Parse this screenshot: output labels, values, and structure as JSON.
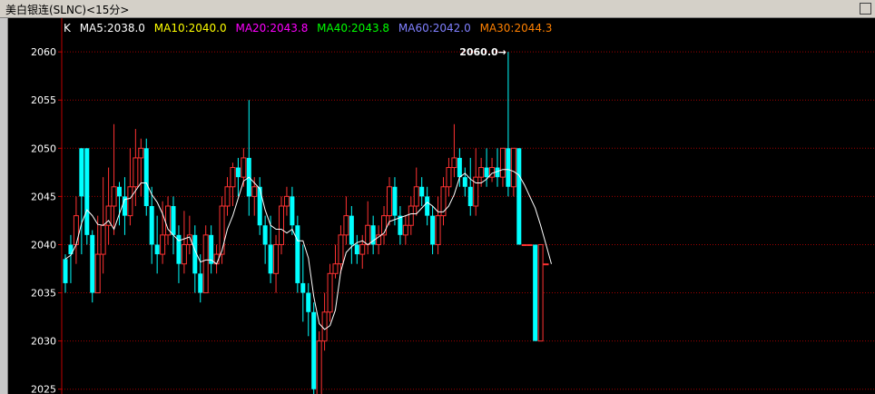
{
  "window": {
    "title": "美白银连(SLNC)<15分>"
  },
  "legend": {
    "type_label": "K",
    "items": [
      {
        "label": "MA5:2038.0",
        "color": "#ffffff"
      },
      {
        "label": "MA10:2040.0",
        "color": "#ffff00"
      },
      {
        "label": "MA20:2043.8",
        "color": "#ff00ff"
      },
      {
        "label": "MA40:2043.8",
        "color": "#00ff00"
      },
      {
        "label": "MA60:2042.0",
        "color": "#8080ff"
      },
      {
        "label": "MA30:2044.3",
        "color": "#ff8000"
      }
    ]
  },
  "annotation": {
    "text": "2060.0→",
    "value": 2060.0
  },
  "colors": {
    "up": "#ff3232",
    "down": "#00ffff",
    "grid": "#a00000",
    "axis": "#c00000",
    "tick_text": "#ffffff"
  },
  "chart_data": {
    "type": "candlestick",
    "ylim": [
      2024.5,
      2063.5
    ],
    "yticks": [
      2025,
      2030,
      2035,
      2040,
      2045,
      2050,
      2055,
      2060
    ],
    "bars": [
      [
        2038.5,
        2036.0,
        2039.0,
        2035.0
      ],
      [
        2040.0,
        2039.0,
        2041.0,
        2036.0
      ],
      [
        2040.0,
        2043.0,
        2045.0,
        2038.0
      ],
      [
        2050.0,
        2045.0,
        2050.0,
        2039.0
      ],
      [
        2050.0,
        2041.0,
        2050.0,
        2040.0
      ],
      [
        2041.0,
        2035.0,
        2041.5,
        2034.0
      ],
      [
        2035.0,
        2039.0,
        2043.0,
        2035.0
      ],
      [
        2039.0,
        2042.0,
        2047.0,
        2037.0
      ],
      [
        2042.0,
        2044.0,
        2048.0,
        2040.0
      ],
      [
        2044.0,
        2046.0,
        2052.5,
        2041.0
      ],
      [
        2046.0,
        2045.0,
        2046.5,
        2042.0
      ],
      [
        2045.0,
        2043.0,
        2047.0,
        2041.0
      ],
      [
        2043.0,
        2046.0,
        2050.0,
        2042.0
      ],
      [
        2046.0,
        2049.0,
        2052.0,
        2044.0
      ],
      [
        2049.0,
        2050.0,
        2051.0,
        2045.0
      ],
      [
        2050.0,
        2044.0,
        2051.0,
        2043.0
      ],
      [
        2044.0,
        2040.0,
        2046.0,
        2038.0
      ],
      [
        2040.0,
        2039.0,
        2043.0,
        2037.0
      ],
      [
        2039.0,
        2041.0,
        2044.5,
        2038.0
      ],
      [
        2041.0,
        2044.0,
        2045.0,
        2040.0
      ],
      [
        2044.0,
        2041.0,
        2045.0,
        2039.0
      ],
      [
        2041.0,
        2038.0,
        2042.0,
        2036.0
      ],
      [
        2038.0,
        2040.0,
        2043.5,
        2037.0
      ],
      [
        2040.0,
        2041.0,
        2043.0,
        2039.0
      ],
      [
        2041.0,
        2037.0,
        2042.0,
        2035.0
      ],
      [
        2037.0,
        2035.0,
        2039.0,
        2034.0
      ],
      [
        2035.0,
        2041.0,
        2042.0,
        2035.0
      ],
      [
        2041.0,
        2038.0,
        2042.0,
        2037.0
      ],
      [
        2038.0,
        2039.0,
        2040.0,
        2037.0
      ],
      [
        2039.0,
        2044.0,
        2045.0,
        2038.0
      ],
      [
        2044.0,
        2046.0,
        2047.0,
        2043.0
      ],
      [
        2046.0,
        2048.0,
        2048.5,
        2044.0
      ],
      [
        2048.0,
        2047.0,
        2049.0,
        2045.0
      ],
      [
        2047.0,
        2049.0,
        2050.0,
        2046.0
      ],
      [
        2049.0,
        2045.0,
        2055.0,
        2043.0
      ],
      [
        2045.0,
        2046.0,
        2047.0,
        2043.0
      ],
      [
        2046.0,
        2042.0,
        2047.0,
        2041.0
      ],
      [
        2042.0,
        2040.0,
        2043.0,
        2038.0
      ],
      [
        2040.0,
        2037.0,
        2043.0,
        2036.0
      ],
      [
        2037.0,
        2040.0,
        2041.0,
        2035.0
      ],
      [
        2040.0,
        2044.0,
        2045.0,
        2039.0
      ],
      [
        2044.0,
        2045.0,
        2046.0,
        2043.0
      ],
      [
        2045.0,
        2042.0,
        2046.0,
        2041.0
      ],
      [
        2042.0,
        2036.0,
        2043.0,
        2035.0
      ],
      [
        2036.0,
        2035.0,
        2040.0,
        2032.0
      ],
      [
        2035.0,
        2033.0,
        2036.0,
        2030.5
      ],
      [
        2033.0,
        2025.0,
        2034.0,
        2024.0
      ],
      [
        2024.0,
        2030.0,
        2031.0,
        2024.5
      ],
      [
        2030.0,
        2033.0,
        2035.0,
        2029.0
      ],
      [
        2033.0,
        2037.0,
        2038.0,
        2032.0
      ],
      [
        2037.0,
        2038.0,
        2040.0,
        2036.5
      ],
      [
        2038.0,
        2041.0,
        2042.0,
        2037.0
      ],
      [
        2041.0,
        2043.0,
        2045.0,
        2040.0
      ],
      [
        2043.0,
        2040.0,
        2044.0,
        2038.0
      ],
      [
        2040.0,
        2039.0,
        2041.0,
        2038.0
      ],
      [
        2039.0,
        2040.0,
        2041.0,
        2037.5
      ],
      [
        2040.0,
        2042.0,
        2044.5,
        2039.0
      ],
      [
        2042.0,
        2040.0,
        2043.0,
        2039.0
      ],
      [
        2040.0,
        2041.0,
        2042.0,
        2039.0
      ],
      [
        2041.0,
        2043.0,
        2044.0,
        2040.0
      ],
      [
        2043.0,
        2046.0,
        2047.0,
        2042.0
      ],
      [
        2046.0,
        2043.0,
        2047.0,
        2042.0
      ],
      [
        2043.0,
        2041.0,
        2044.0,
        2040.0
      ],
      [
        2041.0,
        2042.0,
        2043.0,
        2040.0
      ],
      [
        2042.0,
        2044.0,
        2045.0,
        2041.0
      ],
      [
        2044.0,
        2046.0,
        2048.0,
        2043.0
      ],
      [
        2046.0,
        2045.0,
        2047.0,
        2044.0
      ],
      [
        2045.0,
        2043.0,
        2046.0,
        2042.0
      ],
      [
        2043.0,
        2040.0,
        2044.0,
        2039.0
      ],
      [
        2040.0,
        2043.0,
        2045.0,
        2039.0
      ],
      [
        2043.0,
        2046.0,
        2047.0,
        2042.0
      ],
      [
        2046.0,
        2048.0,
        2049.0,
        2045.0
      ],
      [
        2048.0,
        2049.0,
        2052.5,
        2047.0
      ],
      [
        2049.0,
        2047.0,
        2050.0,
        2046.0
      ],
      [
        2047.0,
        2046.0,
        2048.0,
        2045.0
      ],
      [
        2046.0,
        2044.0,
        2049.0,
        2043.0
      ],
      [
        2044.0,
        2047.0,
        2050.0,
        2043.0
      ],
      [
        2047.0,
        2048.0,
        2049.0,
        2046.0
      ],
      [
        2048.0,
        2047.0,
        2050.0,
        2046.0
      ],
      [
        2047.0,
        2048.0,
        2049.0,
        2046.5
      ],
      [
        2048.0,
        2047.0,
        2050.0,
        2046.0
      ],
      [
        2047.0,
        2050.0,
        2050.0,
        2046.0
      ],
      [
        2050.0,
        2046.0,
        2060.0,
        2045.0
      ],
      [
        2046.0,
        2050.0,
        2050.0,
        2045.0
      ],
      [
        2050.0,
        2040.0,
        2050.0,
        2040.0
      ],
      [
        2040.0,
        2040.0,
        2040.0,
        2040.0
      ],
      [
        2040.0,
        2040.0,
        2040.0,
        2040.0
      ],
      [
        2040.0,
        2030.0,
        2040.0,
        2030.0
      ],
      [
        2030.0,
        2040.0,
        2040.0,
        2030.0
      ],
      [
        2038.0,
        2038.0,
        2038.0,
        2038.0
      ]
    ],
    "ma": {
      "MA5": [
        2038.5,
        2038.9,
        2040.0,
        2042.2,
        2043.6,
        2043.0,
        2042.1,
        2042.0,
        2042.5,
        2041.6,
        2043.2,
        2044.7,
        2044.8,
        2045.6,
        2046.4,
        2046.4,
        2045.2,
        2044.4,
        2043.2,
        2041.6,
        2041.0,
        2040.4,
        2040.6,
        2040.8,
        2039.4,
        2038.2,
        2038.4,
        2038.4,
        2038.0,
        2039.4,
        2041.6,
        2043.0,
        2044.8,
        2046.6,
        2047.0,
        2046.4,
        2045.8,
        2043.6,
        2042.0,
        2041.6,
        2041.6,
        2041.2,
        2041.6,
        2040.4,
        2040.4,
        2038.6,
        2034.6,
        2031.8,
        2031.2,
        2031.6,
        2033.2,
        2037.2,
        2039.2,
        2039.8,
        2040.2,
        2040.4,
        2040.0,
        2040.4,
        2040.8,
        2041.2,
        2042.4,
        2042.6,
        2042.8,
        2043.0,
        2043.2,
        2043.2,
        2043.8,
        2044.4,
        2044.0,
        2043.4,
        2043.4,
        2044.0,
        2045.2,
        2047.0,
        2047.4,
        2046.8,
        2046.4,
        2046.4,
        2046.8,
        2047.4,
        2047.6,
        2047.8,
        2047.8,
        2047.6,
        2047.2,
        2046.2,
        2045.0,
        2043.8,
        2042.0,
        2040.0,
        2038.0
      ]
    }
  }
}
